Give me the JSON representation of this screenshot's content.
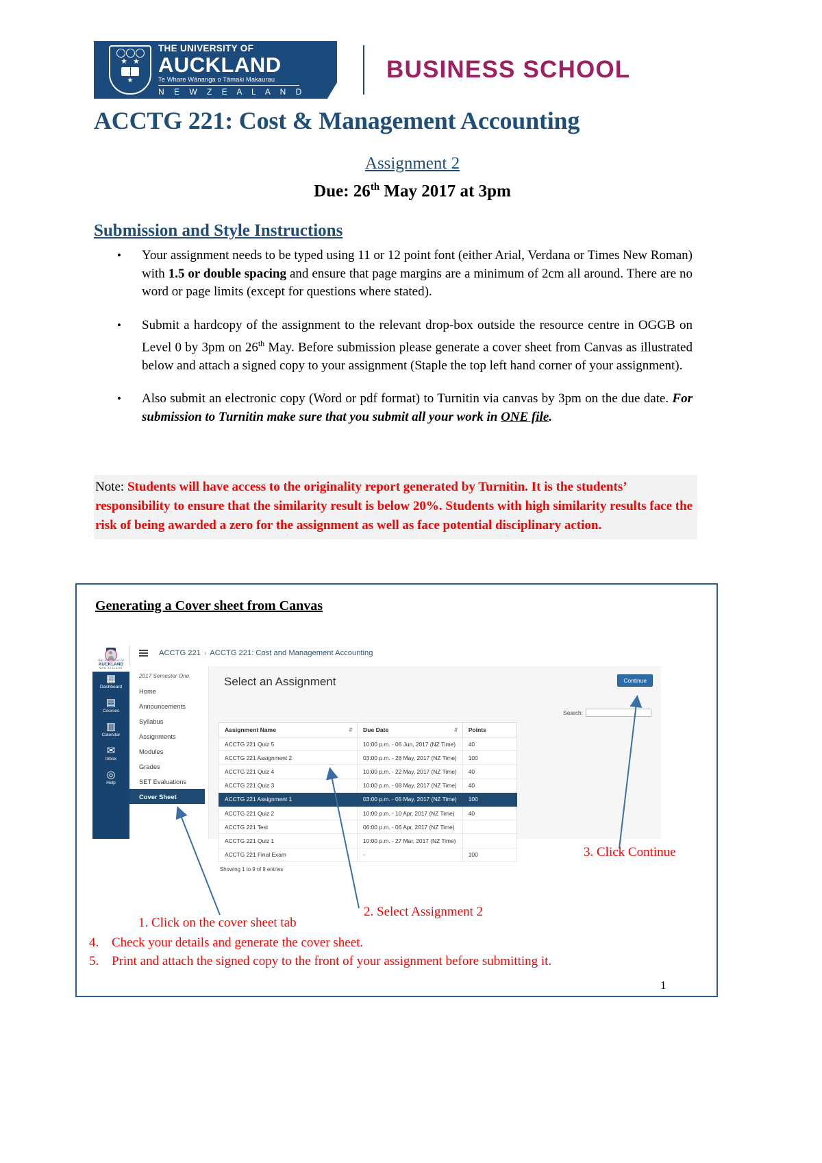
{
  "header": {
    "logo": {
      "line1": "THE UNIVERSITY OF",
      "line2": "AUCKLAND",
      "line3": "Te Whare Wānanga o Tāmaki Makaurau",
      "line4": "N E W   Z E A L A N D"
    },
    "business_school": "BUSINESS SCHOOL"
  },
  "doc": {
    "course_title": "ACCTG 221:  Cost & Management Accounting",
    "assignment": "Assignment 2",
    "due_prefix": "Due:  26",
    "due_sup": "th",
    "due_suffix": " May 2017 at 3pm",
    "section_heading": "Submission and Style Instructions"
  },
  "bullets": [
    {
      "marker": "•",
      "parts": [
        {
          "text": "Your assignment needs to be typed using 11 or 12 point font (either Arial, Verdana or Times New Roman) with ",
          "style": "normal"
        },
        {
          "text": "1.5 or double spacing",
          "style": "bold"
        },
        {
          "text": " and ensure that page margins are a minimum of 2cm all around. There are no word or page limits (except for questions where stated).",
          "style": "normal"
        }
      ]
    },
    {
      "marker": "•",
      "parts": [
        {
          "text": "Submit a hardcopy of the assignment to the relevant drop-box outside the resource centre in OGGB on Level 0 by 3pm on 26",
          "style": "normal"
        },
        {
          "text": "th",
          "style": "sup"
        },
        {
          "text": " May. Before submission please generate a cover sheet from Canvas as illustrated below and attach a signed copy to your assignment (Staple the top left hand corner of your assignment).",
          "style": "normal"
        }
      ]
    },
    {
      "marker": "•",
      "parts": [
        {
          "text": "Also submit an electronic copy (Word or pdf format) to Turnitin via canvas by 3pm on the due date. ",
          "style": "normal"
        },
        {
          "text": "For submission to Turnitin make sure that you submit all your work in ",
          "style": "bolditalic"
        },
        {
          "text": "ONE file",
          "style": "bolditalic-underline"
        },
        {
          "text": ".",
          "style": "bolditalic"
        }
      ]
    }
  ],
  "note": {
    "label": "Note: ",
    "text": "Students will have access to the originality report generated by Turnitin. It is the students’ responsibility to ensure that the similarity result is below 20%. Students with high similarity results face the risk of being awarded a zero for the assignment as well as face potential disciplinary action."
  },
  "screenshot_panel": {
    "title": "Generating a Cover sheet from Canvas",
    "canvas": {
      "global_nav": [
        {
          "icon": "avatar-icon",
          "label": "Account"
        },
        {
          "icon": "dashboard-icon",
          "label": "Dashboard"
        },
        {
          "icon": "courses-icon",
          "label": "Courses"
        },
        {
          "icon": "calendar-icon",
          "label": "Calendar"
        },
        {
          "icon": "inbox-icon",
          "label": "Inbox"
        },
        {
          "icon": "help-icon",
          "label": "Help"
        }
      ],
      "breadcrumb": {
        "course_code": "ACCTG 221",
        "separator": "›",
        "course_name": "ACCTG 221: Cost and Management Accounting"
      },
      "term": "2017 Semester One",
      "course_nav": [
        {
          "label": "Home",
          "active": false
        },
        {
          "label": "Announcements",
          "active": false
        },
        {
          "label": "Syllabus",
          "active": false
        },
        {
          "label": "Assignments",
          "active": false
        },
        {
          "label": "Modules",
          "active": false
        },
        {
          "label": "Grades",
          "active": false
        },
        {
          "label": "SET Evaluations",
          "active": false
        },
        {
          "label": "Cover Sheet",
          "active": true
        }
      ],
      "page_heading": "Select an Assignment",
      "continue_button": "Continue",
      "search_label": "Search:",
      "search_value": "",
      "table": {
        "columns": [
          "Assignment Name",
          "Due Date",
          "Points"
        ],
        "rows": [
          {
            "name": "ACCTG 221 Quiz 5",
            "due": "10:00 p.m. - 06 Jun, 2017 (NZ Time)",
            "points": "40",
            "selected": false
          },
          {
            "name": "ACCTG 221 Assignment 2",
            "due": "03:00 p.m. - 28 May, 2017 (NZ Time)",
            "points": "100",
            "selected": false
          },
          {
            "name": "ACCTG 221 Quiz 4",
            "due": "10:00 p.m. - 22 May, 2017 (NZ Time)",
            "points": "40",
            "selected": false
          },
          {
            "name": "ACCTG 221 Quiz 3",
            "due": "10:00 p.m. - 08 May, 2017 (NZ Time)",
            "points": "40",
            "selected": false
          },
          {
            "name": "ACCTG 221 Assignment 1",
            "due": "03:00 p.m. - 05 May, 2017 (NZ Time)",
            "points": "100",
            "selected": true
          },
          {
            "name": "ACCTG 221 Quiz 2",
            "due": "10:00 p.m. - 10 Apr, 2017 (NZ Time)",
            "points": "40",
            "selected": false
          },
          {
            "name": "ACCTG 221 Test",
            "due": "06:00 p.m. - 06 Apr, 2017 (NZ Time)",
            "points": "",
            "selected": false
          },
          {
            "name": "ACCTG 221 Quiz 1",
            "due": "10:00 p.m. - 27 Mar, 2017 (NZ Time)",
            "points": "",
            "selected": false
          },
          {
            "name": "ACCTG 221 Final Exam",
            "due": "-",
            "points": "100",
            "selected": false
          }
        ],
        "footer": "Showing 1 to 9 of 9 entries"
      }
    },
    "annotations": [
      {
        "id": "anno-1",
        "text": "1.   Click on the cover sheet tab"
      },
      {
        "id": "anno-2",
        "text": "2. Select Assignment 2"
      },
      {
        "id": "anno-3",
        "text": "3. Click Continue"
      }
    ],
    "steps": [
      {
        "num": "4.",
        "text": "Check your details and generate the cover sheet."
      },
      {
        "num": "5.",
        "text": "Print and attach the signed copy to the front of your assignment before submitting it."
      }
    ]
  },
  "page_number": "1"
}
